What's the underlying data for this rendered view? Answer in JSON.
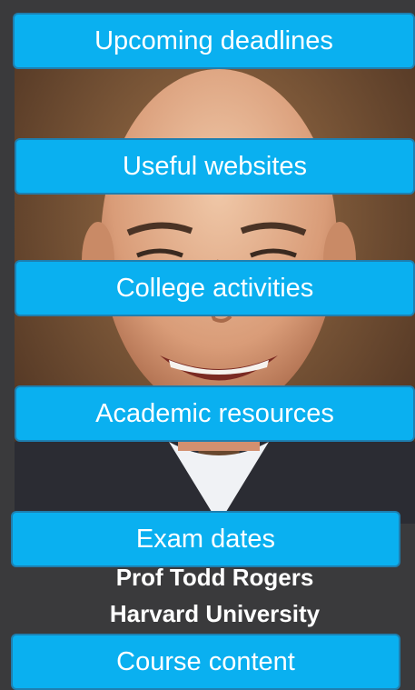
{
  "nav": {
    "items": [
      {
        "label": "Upcoming deadlines"
      },
      {
        "label": "Useful websites"
      },
      {
        "label": "College activities"
      },
      {
        "label": "Academic resources"
      },
      {
        "label": "Exam dates"
      },
      {
        "label": "Course content"
      }
    ]
  },
  "profile": {
    "name": "Prof Todd Rogers",
    "institution": "Harvard University"
  },
  "colors": {
    "button_fill": "#0ab0f0",
    "button_border": "#1e7fb0",
    "background": "#3a3a3c"
  }
}
